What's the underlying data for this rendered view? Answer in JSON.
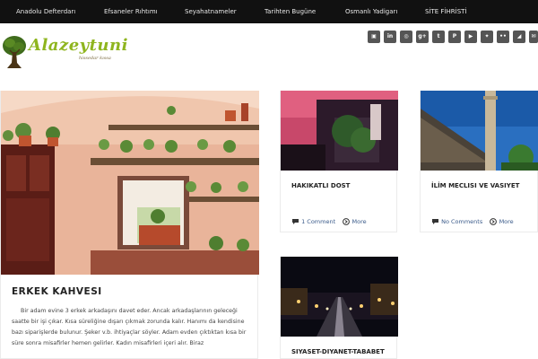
{
  "topnav": {
    "items": [
      "Anadolu Defterdarı",
      "Efsaneler Rıhtımı",
      "Seyahatnameler",
      "Tarihten Bugüne",
      "Osmanlı Yadigarı",
      "SİTE FİHRİSTİ"
    ]
  },
  "logo": {
    "text": "Alazeytuni",
    "tagline": "hissedar kıssa"
  },
  "social": [
    "instagram-icon",
    "linkedin-icon",
    "dribbble-icon",
    "google-plus-icon",
    "tumblr-icon",
    "pinterest-icon",
    "youtube-icon",
    "twitter-icon",
    "flickr-icon",
    "rss-icon",
    "email-icon"
  ],
  "featured": {
    "title": "ERKEK KAHVESI",
    "excerpt": "Bir adam evine 3 erkek arkadaşını davet eder. Ancak arkadaşlarının geleceği saatte bir işi çıkar. Kısa süreliğine dışarı çıkmak zorunda kalır.      Hanımı da kendisine bazı siparişlerde bulunur. Şeker v.b. ihtiyaçlar söyler. Adam evden çıktıktan kısa bir süre sonra misafirler hemen gelirler. Kadın misafirleri içeri alır. Biraz"
  },
  "posts": [
    {
      "title": "HAKIKATLI DOST",
      "comments": "1 Comment",
      "more": "More"
    },
    {
      "title": "İLİM MECLISI VE VASIYET",
      "comments": "No Comments",
      "more": "More"
    },
    {
      "title": "SIYASET-DIYANET-TABABET"
    }
  ],
  "colors": {
    "nav_bg": "#111111",
    "logo_green": "#8fb51f",
    "link_blue": "#3a5a8a"
  }
}
